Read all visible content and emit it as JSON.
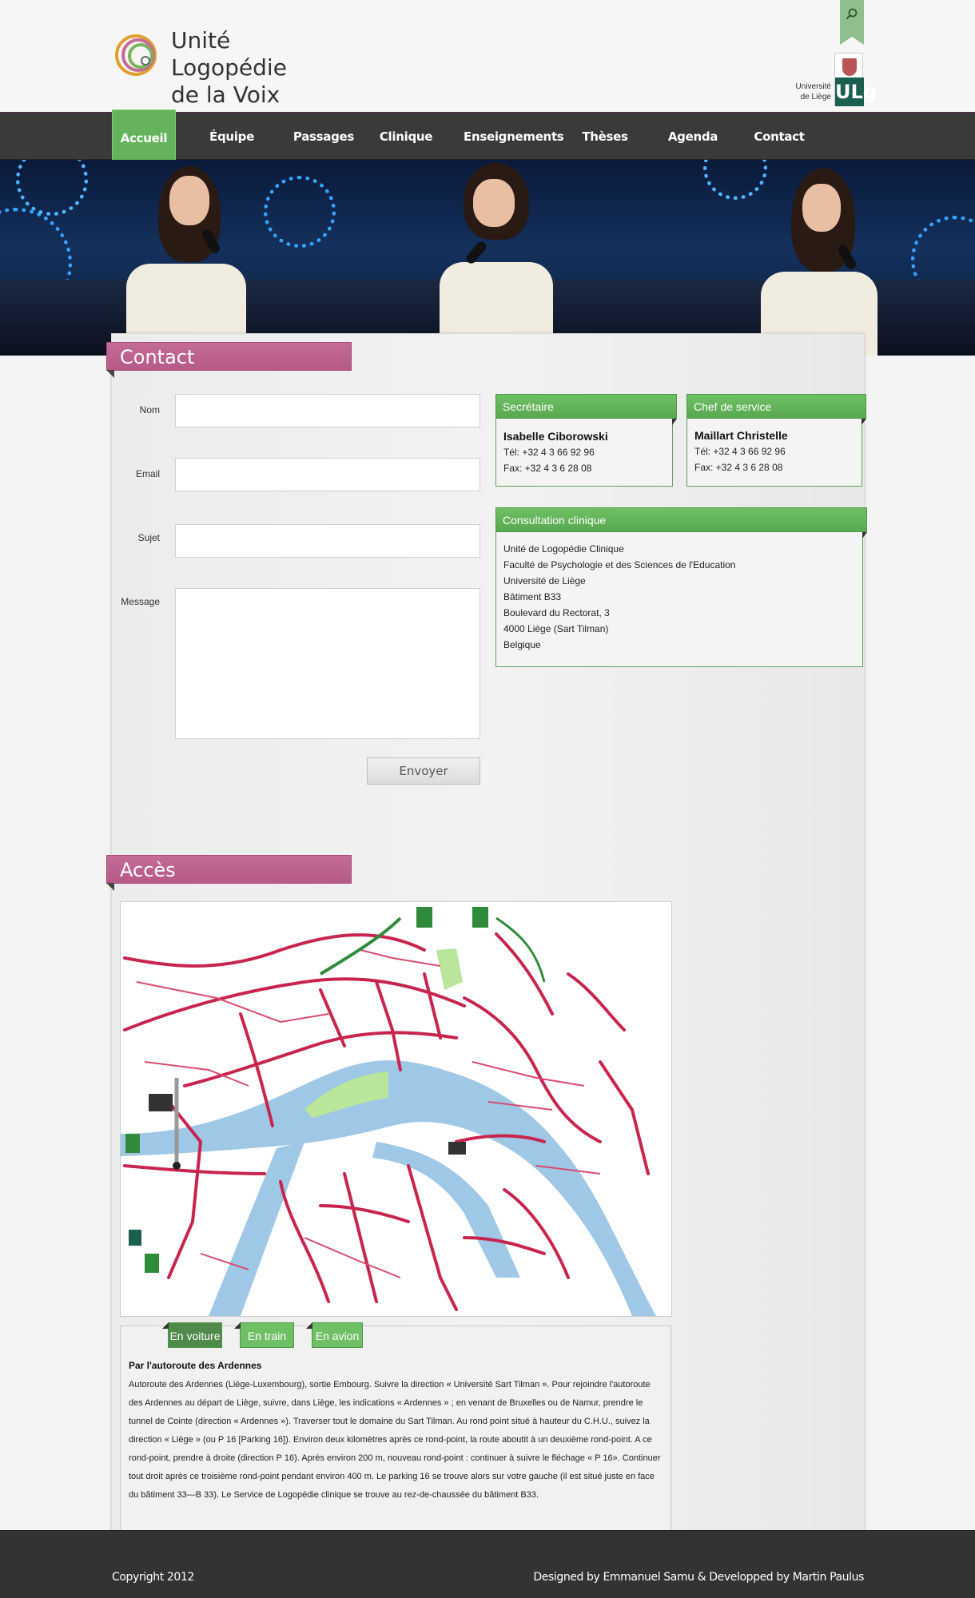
{
  "header": {
    "site_title": "Unité Logopédie\nde la Voix",
    "university": "Université\nde Liège",
    "university_mark": "ULg"
  },
  "nav": {
    "items": [
      "Accueil",
      "Équipe",
      "Passages",
      "Clinique",
      "Enseignements",
      "Thèses",
      "Agenda",
      "Contact"
    ],
    "active": "Accueil"
  },
  "contact": {
    "heading": "Contact",
    "fields": {
      "name": "Nom",
      "email": "Email",
      "subject": "Sujet",
      "message": "Message"
    },
    "submit": "Envoyer"
  },
  "secretary": {
    "title": "Secrétaire",
    "name": "Isabelle Ciborowski",
    "tel": "Tél: +32 4 3 66 92 96",
    "fax": "Fax: +32 4 3 6 28 08"
  },
  "chief": {
    "title": "Chef de service",
    "name": "Maillart Christelle",
    "tel": "Tél: +32 4 3 66 92 96",
    "fax": "Fax: +32 4 3 6 28 08"
  },
  "consultation": {
    "title": "Consultation clinique",
    "lines": [
      "Unité de Logopédie Clinique",
      "Faculté de Psychologie et des Sciences de l'Education",
      "Université de Liège",
      "Bâtiment B33",
      "Boulevard du Rectorat, 3",
      "4000 Liège (Sart Tilman)",
      "Belgique"
    ]
  },
  "access": {
    "heading": "Accès",
    "tabs": [
      "En voiture",
      "En train",
      "En avion"
    ],
    "active_tab": "En voiture",
    "direction_title": "Par l'autoroute des Ardennes",
    "direction_text": "Autoroute des Ardennes (Liège-Luxembourg), sortie Embourg. Suivre la direction « Université Sart Tilman ». Pour rejoindre l'autoroute des Ardennes au départ de Liège, suivre, dans Liège, les indications « Ardennes » ; en venant de Bruxelles ou de Namur, prendre le tunnel de Cointe (direction « Ardennes »). Traverser tout le domaine du Sart Tilman. Au rond point situé à hauteur du C.H.U., suivez la direction « Liège » (ou P 16 [Parking 16]). Environ deux kilomètres après ce rond-point, la route aboutit à un deuxième rond-point. A ce rond-point, prendre à droite (direction P 16). Après environ 200 m, nouveau rond-point : continuer à suivre le fléchage « P 16». Continuer tout droit après ce troisième rond-point pendant environ 400 m. Le parking 16 se trouve alors sur votre gauche (il est situé juste en face du bâtiment 33—B 33). Le Service de Logopédie clinique se trouve au rez-de-chaussée du bâtiment B33."
  },
  "footer": {
    "copyright": "Copyright 2012",
    "credits": "Designed by Emmanuel Samu & Developped by Martin Paulus"
  },
  "colors": {
    "accent_green": "#66b35e",
    "accent_pink": "#c46b97",
    "nav_bg": "#3a3a3a"
  }
}
